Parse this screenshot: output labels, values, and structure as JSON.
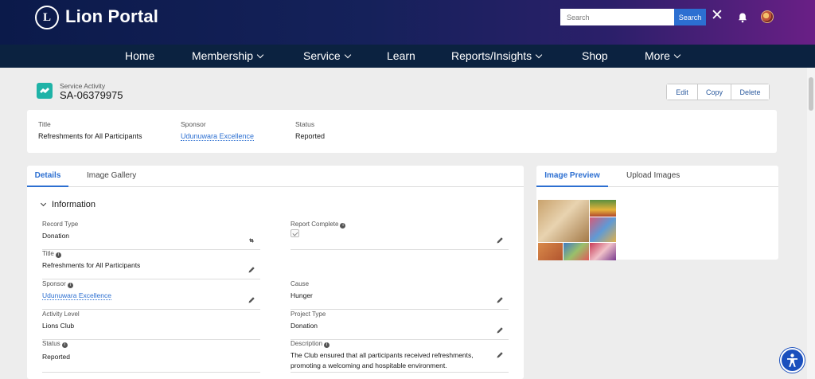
{
  "header": {
    "brand": "Lion Portal",
    "logo_glyph": "L",
    "search": {
      "placeholder": "Search",
      "button_label": "Search"
    },
    "icons": [
      "lions-logo-icon",
      "close-icon",
      "notification-bell-icon",
      "user-avatar"
    ]
  },
  "nav": {
    "items": [
      {
        "label": "Home",
        "has_menu": false
      },
      {
        "label": "Membership",
        "has_menu": true
      },
      {
        "label": "Service",
        "has_menu": true
      },
      {
        "label": "Learn",
        "has_menu": false
      },
      {
        "label": "Reports/Insights",
        "has_menu": true
      },
      {
        "label": "Shop",
        "has_menu": false
      },
      {
        "label": "More",
        "has_menu": true
      }
    ]
  },
  "record": {
    "type_label": "Service Activity",
    "id": "SA-06379975",
    "actions": [
      "Edit",
      "Copy",
      "Delete"
    ]
  },
  "highlights": [
    {
      "label": "Title",
      "value": "Refreshments for All Participants",
      "is_link": false
    },
    {
      "label": "Sponsor",
      "value": "Udunuwara Excellence",
      "is_link": true
    },
    {
      "label": "Status",
      "value": "Reported",
      "is_link": false
    }
  ],
  "main_tabs": {
    "details": "Details",
    "gallery": "Image Gallery"
  },
  "section": {
    "title": "Information"
  },
  "fields": {
    "record_type": {
      "label": "Record Type",
      "value": "Donation"
    },
    "report_complete": {
      "label": "Report Complete",
      "checked": true
    },
    "title": {
      "label": "Title",
      "value": "Refreshments for All Participants"
    },
    "sponsor": {
      "label": "Sponsor",
      "value": "Udunuwara Excellence"
    },
    "cause": {
      "label": "Cause",
      "value": "Hunger"
    },
    "activity_level": {
      "label": "Activity Level",
      "value": "Lions Club"
    },
    "project_type": {
      "label": "Project Type",
      "value": "Donation"
    },
    "status": {
      "label": "Status",
      "value": "Reported"
    },
    "description": {
      "label": "Description",
      "value": "The Club ensured that all participants received refreshments, promoting a welcoming and hospitable environment."
    }
  },
  "image_tabs": {
    "preview": "Image Preview",
    "upload": "Upload Images"
  },
  "colors": {
    "accent": "#2c6fd1",
    "nav_bg": "#0b2240",
    "record_icon": "#1fb3a7"
  }
}
